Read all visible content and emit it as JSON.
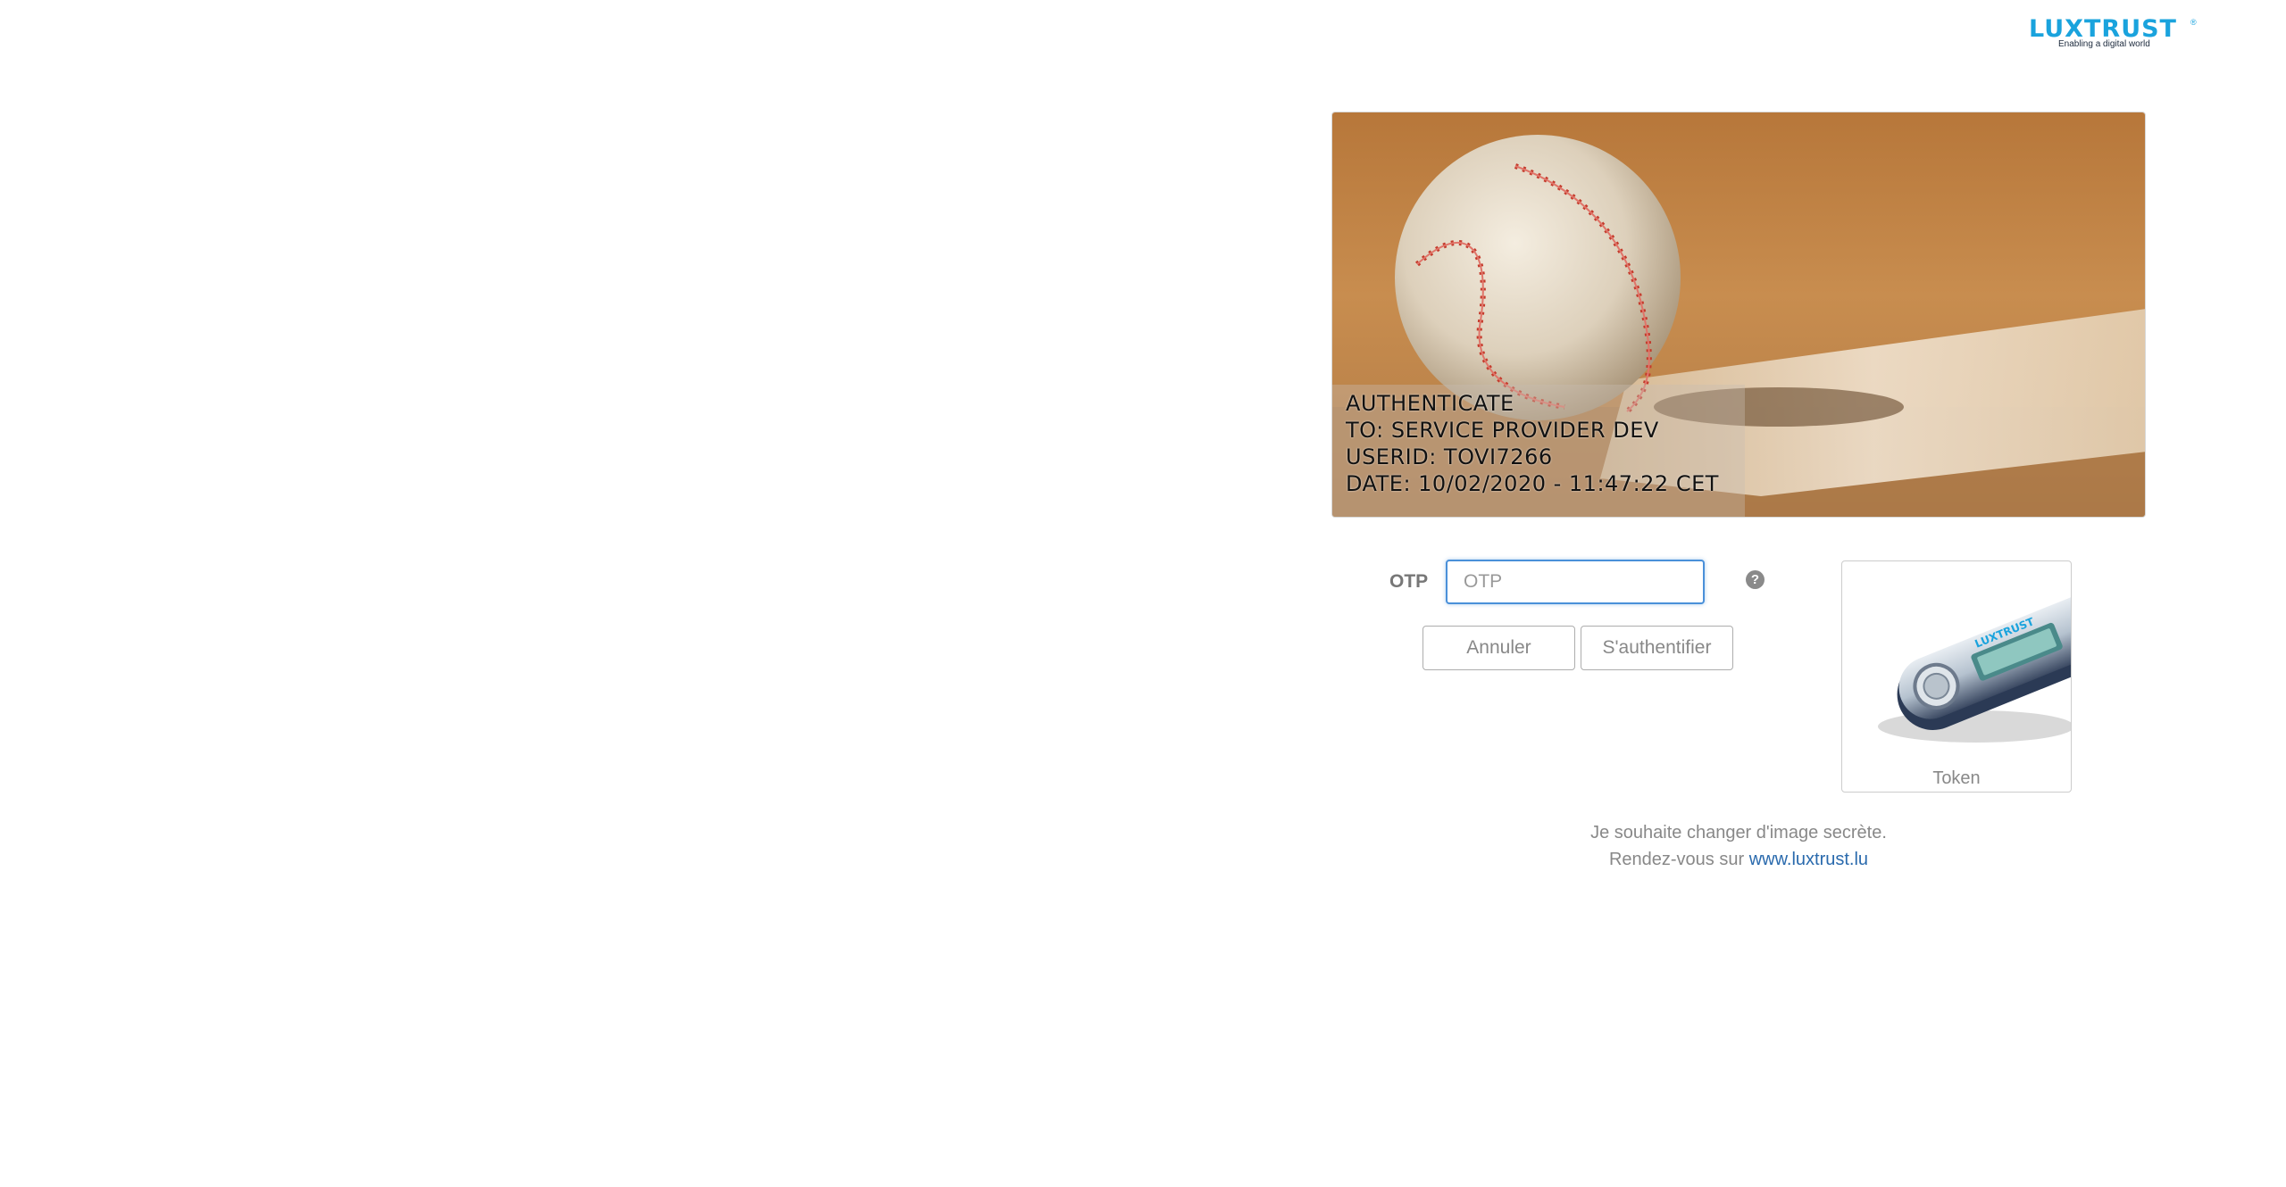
{
  "brand": {
    "logo_text": "LUXTRUST",
    "registered_mark": "®",
    "tagline": "Enabling a digital world",
    "color": "#1aa3dd"
  },
  "secret_image": {
    "subject": "baseball on infield dirt",
    "caption_lines": [
      "AUTHENTICATE",
      "TO: SERVICE PROVIDER DEV",
      "USERID: TOVI7266",
      "DATE: 10/02/2020 - 11:47:22 CET"
    ]
  },
  "form": {
    "otp_label": "OTP",
    "otp_placeholder": "OTP",
    "otp_value": "",
    "help_icon": "question-circle-icon",
    "cancel_label": "Annuler",
    "submit_label": "S'authentifier",
    "focus_color": "#4a90d9"
  },
  "token": {
    "label": "Token",
    "icon": "luxtrust-token-device"
  },
  "footer": {
    "line1": "Je souhaite changer d'image secrète.",
    "line2_prefix": "Rendez-vous sur",
    "link_text": "www.luxtrust.lu",
    "link_color": "#2a6aad"
  }
}
